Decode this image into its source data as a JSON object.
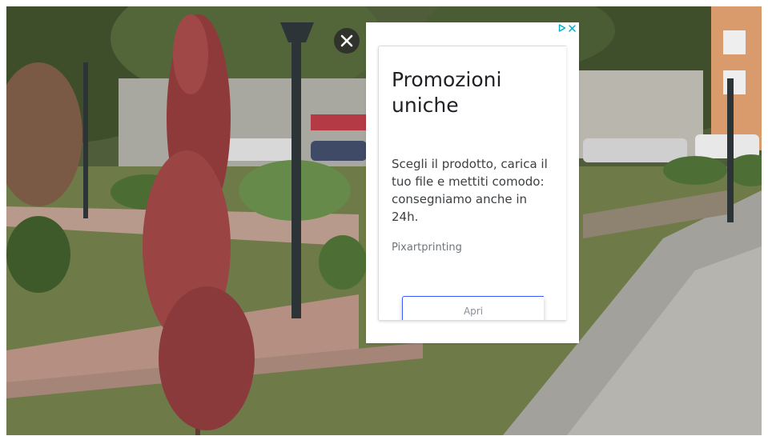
{
  "ad": {
    "headline": "Promozioni uniche",
    "body": "Scegli il prodotto, carica il tuo file e mettiti comodo: consegniamo anche in 24h.",
    "advertiser": "Pixartprinting",
    "cta_label": "Apri",
    "adchoices_icon": "adchoices-icon",
    "close_ad_icon": "close-x-icon",
    "accent_color": "#3d5afe",
    "adchoices_color": "#00aecd"
  },
  "overlay": {
    "close_icon": "close-icon"
  }
}
